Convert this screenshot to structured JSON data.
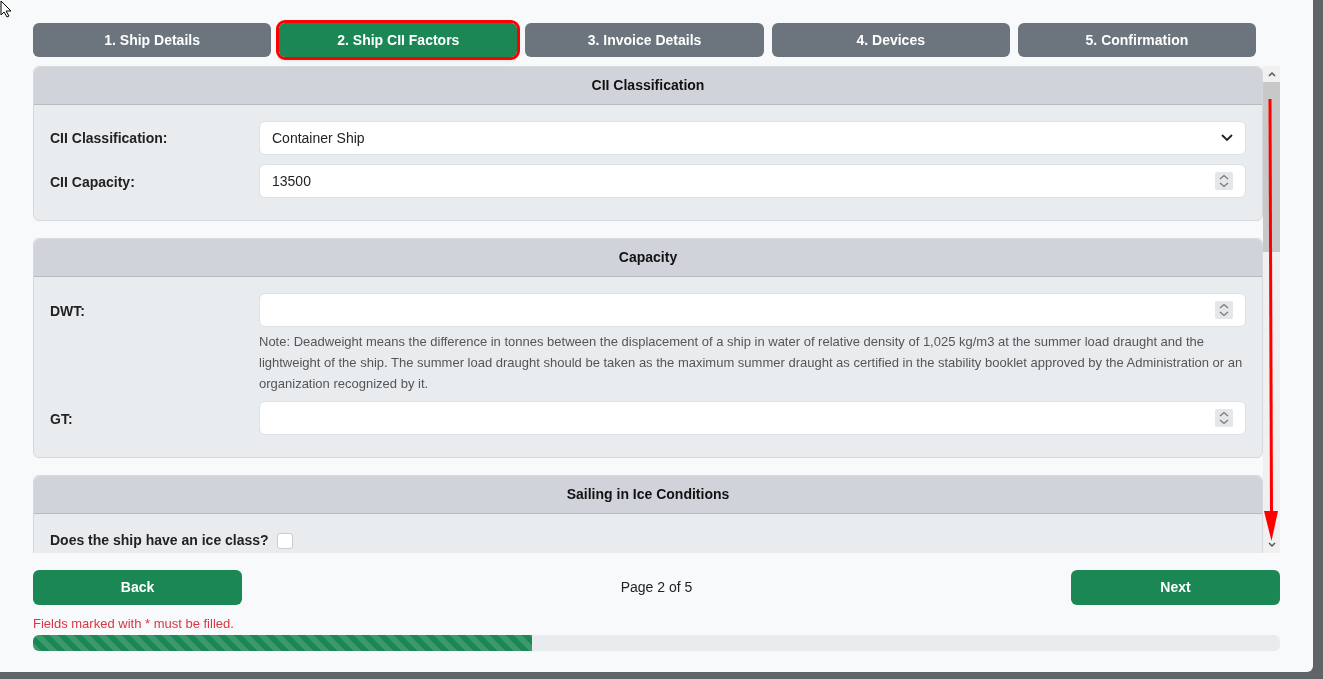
{
  "tabs": [
    {
      "label": "1. Ship Details",
      "selected": false,
      "highlighted": false
    },
    {
      "label": "2. Ship CII Factors",
      "selected": true,
      "highlighted": true
    },
    {
      "label": "3. Invoice Details",
      "selected": false,
      "highlighted": false
    },
    {
      "label": "4. Devices",
      "selected": false,
      "highlighted": false
    },
    {
      "label": "5. Confirmation",
      "selected": false,
      "highlighted": false
    }
  ],
  "sections": [
    {
      "title": "CII Classification",
      "fields": [
        {
          "kind": "select",
          "label": "CII Classification:",
          "value": "Container Ship"
        },
        {
          "kind": "number",
          "label": "CII Capacity:",
          "value": "13500"
        }
      ]
    },
    {
      "title": "Capacity",
      "fields": [
        {
          "kind": "number",
          "label": "DWT:",
          "note": "Note: Deadweight means the difference in tonnes between the displacement of a ship in water of relative density of 1,025 kg/m3 at the summer load draught and the lightweight of the ship. The summer load draught should be taken as the maximum summer draught as certified in the stability booklet approved by the Administration or an organization recognized by it."
        },
        {
          "kind": "number",
          "label": "GT:"
        }
      ]
    },
    {
      "title": "Sailing in Ice Conditions",
      "fields": [
        {
          "kind": "checkbox",
          "label": "Does the ship have an ice class?",
          "checked": false
        }
      ]
    }
  ],
  "footer": {
    "back": "Back",
    "page": "Page 2 of 5",
    "next": "Next",
    "message": "Fields marked with * must be filled.",
    "progress": {
      "level": 0.4
    }
  }
}
